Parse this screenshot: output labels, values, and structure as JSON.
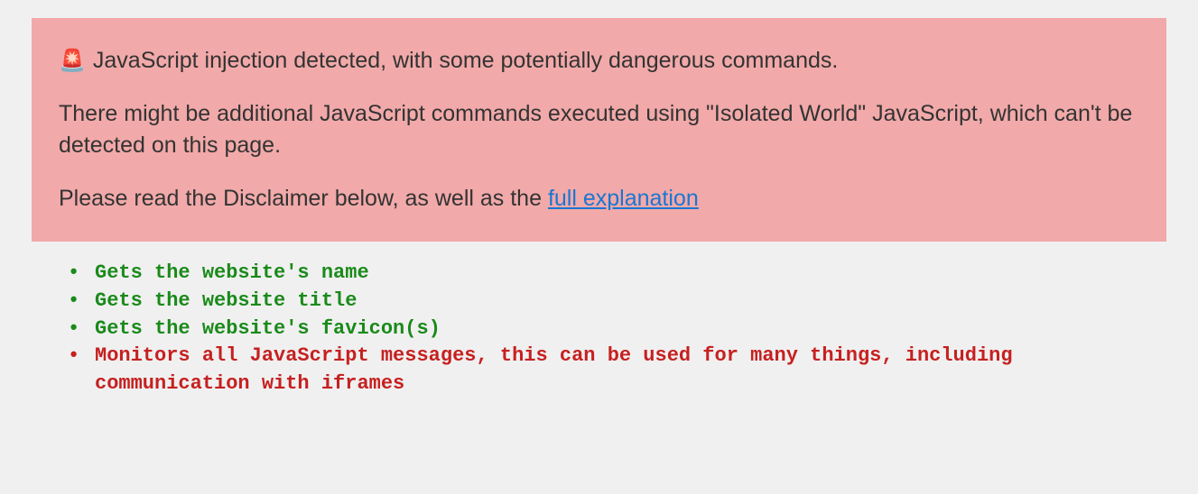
{
  "alert": {
    "icon": "🚨",
    "title_text": "JavaScript injection detected, with some potentially dangerous commands.",
    "body_text": "There might be additional JavaScript commands executed using \"Isolated World\" JavaScript, which can't be detected on this page.",
    "footer_prefix": "Please read the Disclaimer below, as well as the ",
    "link_text": "full explanation"
  },
  "findings": [
    {
      "text": "Gets the website's name",
      "severity": "green"
    },
    {
      "text": "Gets the website title",
      "severity": "green"
    },
    {
      "text": "Gets the website's favicon(s)",
      "severity": "green"
    },
    {
      "text": "Monitors all JavaScript messages, this can be used for many things, including communication with iframes",
      "severity": "red"
    }
  ]
}
